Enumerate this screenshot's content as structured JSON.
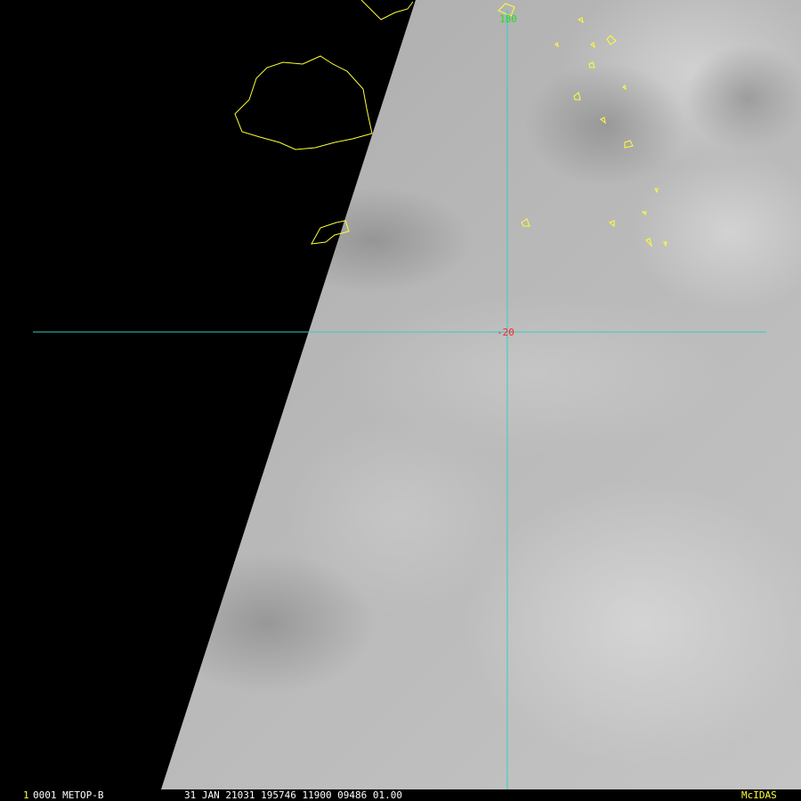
{
  "colors": {
    "coastline": "#ffff33",
    "gridline": "#33cccc",
    "latitude_label": "#ff2222",
    "longitude_label": "#22dd22",
    "status_text": "#ffffff",
    "frame_number": "#ffff33",
    "software_label": "#ffff33"
  },
  "map": {
    "latitude_label": "-20",
    "longitude_label": "180"
  },
  "status_bar": {
    "frame_number": "1",
    "frame_info": "0001 METOP-B",
    "date_time_info": "31 JAN 21031 195746 11900 09486 01.00",
    "software": "McIDAS"
  }
}
